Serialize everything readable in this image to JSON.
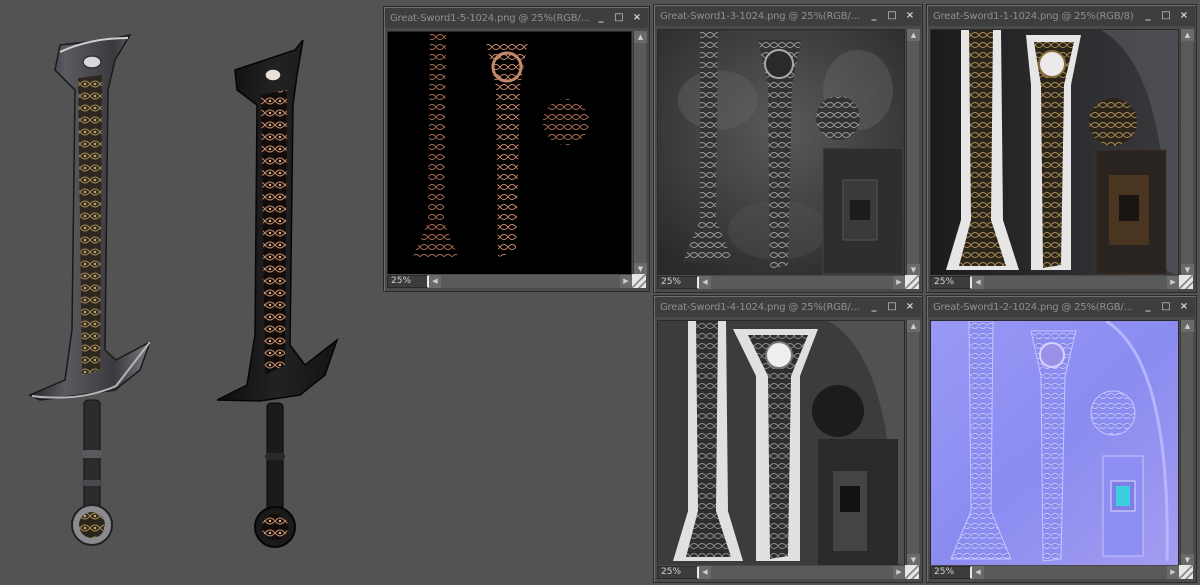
{
  "windows": [
    {
      "title": "Great-Sword1-5-1024.png @ 25%(RGB/...",
      "zoom": "25%",
      "canvas_style": "emissive"
    },
    {
      "title": "Great-Sword1-3-1024.png @ 25%(RGB/...",
      "zoom": "25%",
      "canvas_style": "gloss"
    },
    {
      "title": "Great-Sword1-1-1024.png @ 25%(RGB/8)",
      "zoom": "25%",
      "canvas_style": "diffuse"
    },
    {
      "title": "Great-Sword1-4-1024.png @ 25%(RGB/...",
      "zoom": "25%",
      "canvas_style": "specular"
    },
    {
      "title": "Great-Sword1-2-1024.png @ 25%(RGB/...",
      "zoom": "25%",
      "canvas_style": "normal"
    }
  ],
  "window_buttons": {
    "minimize": "_",
    "maximize": "□",
    "close": "×"
  },
  "icons": {
    "minimize": "minimize-icon",
    "maximize": "maximize-icon",
    "close": "close-icon",
    "scroll_up": "arrow-up-icon",
    "scroll_down": "arrow-down-icon",
    "scroll_left": "arrow-left-icon",
    "scroll_right": "arrow-right-icon",
    "resize": "resize-grip-icon"
  },
  "colors": {
    "workspace": "#535353",
    "window_bg": "#4a4a4a",
    "titlebar": "#3e3e3e",
    "title_text": "#8f8f8f",
    "normal_map_base": "#8a8cf0"
  }
}
